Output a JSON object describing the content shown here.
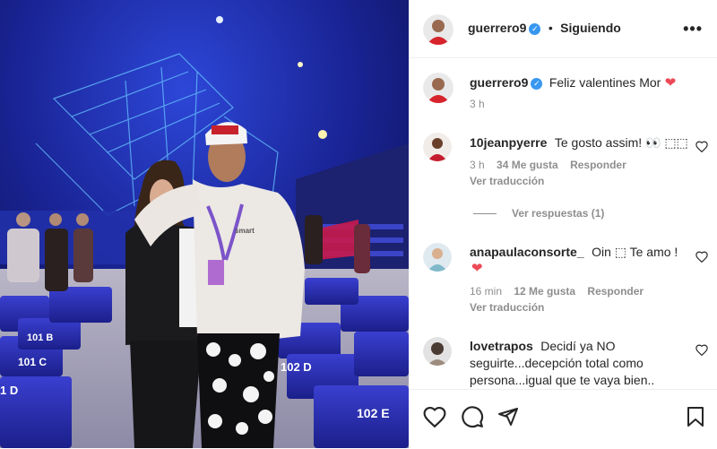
{
  "header": {
    "username": "guerrero9",
    "separator": "•",
    "follow_label": "Siguiendo",
    "more_icon": "more-horizontal-icon"
  },
  "caption": {
    "username": "guerrero9",
    "text": "Feliz valentines Mor",
    "heart": "❤",
    "time": "3 h"
  },
  "comments": [
    {
      "username": "10jeanpyerre",
      "text": "Te gosto assim! 👀 ⬚⬚",
      "time": "3 h",
      "likes": "34 Me gusta",
      "reply": "Responder",
      "translate": "Ver traducción",
      "replies_label": "Ver respuestas (1)"
    },
    {
      "username": "anapaulaconsorte_",
      "text": "Oin ⬚ Te amo !",
      "heart": "❤",
      "time": "16 min",
      "likes": "12 Me gusta",
      "reply": "Responder",
      "translate": "Ver traducción"
    },
    {
      "username": "lovetrapos",
      "text_lines": [
        "Decidí ya NO",
        "seguirte...decepción total como",
        "persona...igual que te vaya bien.."
      ]
    }
  ],
  "photo": {
    "seat_labels": [
      "102 D",
      "102 E",
      "101 C",
      "101 B",
      "1 D"
    ],
    "shirt_text": "smart"
  },
  "colors": {
    "accent": "#3897f0",
    "heart": "#ed4956",
    "muted": "#8e8e8e"
  }
}
